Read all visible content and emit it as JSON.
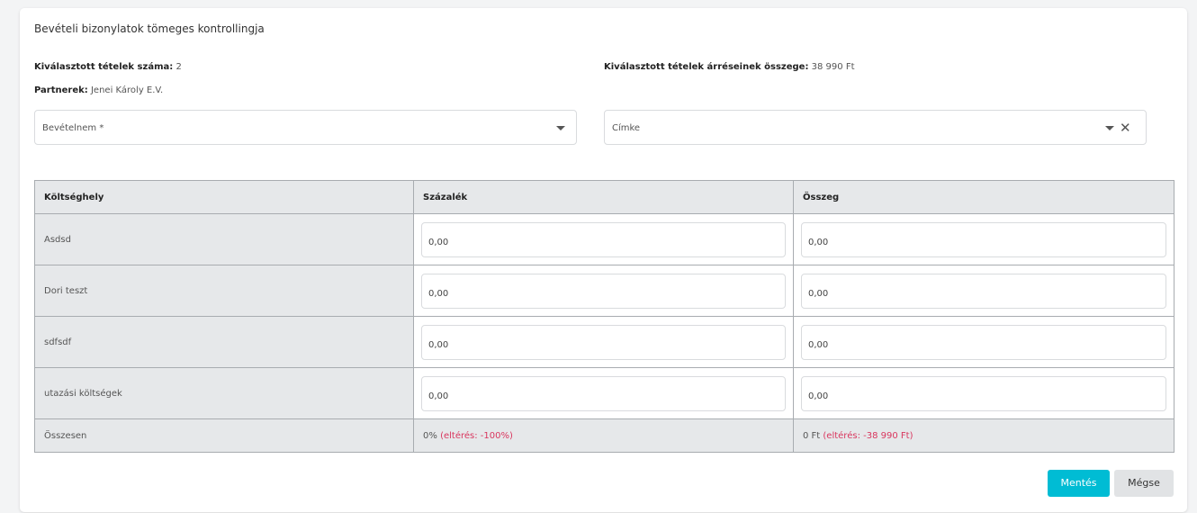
{
  "title": "Bevételi bizonylatok tömeges kontrollingja",
  "info": {
    "selected_count_label": "Kiválasztott tételek száma:",
    "selected_count_value": "2",
    "partners_label": "Partnerek:",
    "partners_value": "Jenei Károly E.V.",
    "margin_sum_label": "Kiválasztott tételek árréseinek összege:",
    "margin_sum_value": "38 990 Ft"
  },
  "fields": {
    "revenue_type_placeholder": "Bevételnem *",
    "tag_placeholder": "Címke"
  },
  "table": {
    "headers": [
      "Költséghely",
      "Százalék",
      "Összeg"
    ],
    "rows": [
      {
        "name": "Asdsd",
        "percent": "0,00",
        "amount": "0,00"
      },
      {
        "name": "Dori teszt",
        "percent": "0,00",
        "amount": "0,00"
      },
      {
        "name": "sdfsdf",
        "percent": "0,00",
        "amount": "0,00"
      },
      {
        "name": "utazási költségek",
        "percent": "0,00",
        "amount": "0,00"
      }
    ],
    "total": {
      "label": "Összesen",
      "percent": "0%",
      "percent_diff": "(eltérés: -100%)",
      "amount": "0 Ft",
      "amount_diff": "(eltérés: -38 990 Ft)"
    }
  },
  "buttons": {
    "save": "Mentés",
    "cancel": "Mégse"
  },
  "icons": {
    "dropdown": "chevron-down-icon",
    "clear": "close-icon"
  },
  "colors": {
    "accent": "#00bcd4",
    "diff": "#d9365e"
  }
}
